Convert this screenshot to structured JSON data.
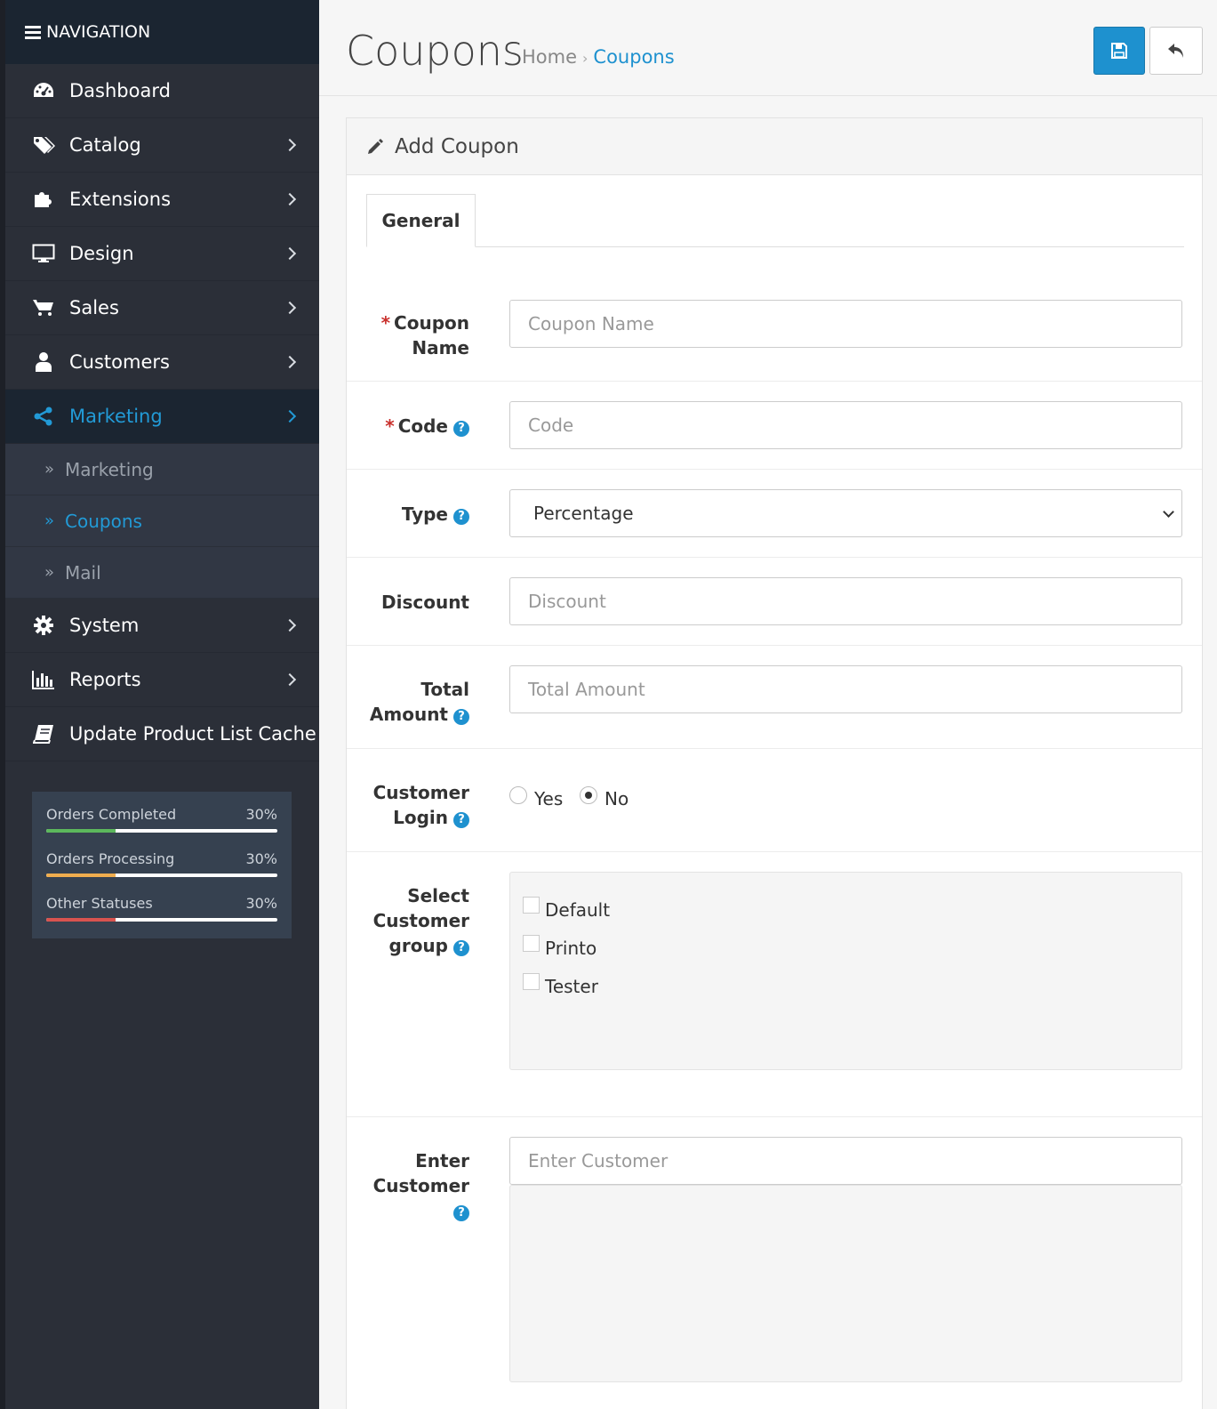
{
  "sidebar": {
    "header": "NAVIGATION",
    "items": [
      {
        "label": "Dashboard",
        "icon": "dashboard-icon"
      },
      {
        "label": "Catalog",
        "icon": "tags-icon"
      },
      {
        "label": "Extensions",
        "icon": "puzzle-icon"
      },
      {
        "label": "Design",
        "icon": "monitor-icon"
      },
      {
        "label": "Sales",
        "icon": "cart-icon"
      },
      {
        "label": "Customers",
        "icon": "user-icon"
      },
      {
        "label": "Marketing",
        "icon": "share-icon"
      },
      {
        "label": "System",
        "icon": "gear-icon"
      },
      {
        "label": "Reports",
        "icon": "bar-chart-icon"
      },
      {
        "label": "Update Product List Cache",
        "icon": "book-icon"
      }
    ],
    "submenu": [
      {
        "label": "Marketing"
      },
      {
        "label": "Coupons"
      },
      {
        "label": "Mail"
      }
    ],
    "stats": [
      {
        "label": "Orders Completed",
        "value": "30%",
        "fraction": 0.3,
        "color": "#5cb85c"
      },
      {
        "label": "Orders Processing",
        "value": "30%",
        "fraction": 0.3,
        "color": "#f0ad4e"
      },
      {
        "label": "Other Statuses",
        "value": "30%",
        "fraction": 0.3,
        "color": "#d9534f"
      }
    ]
  },
  "header": {
    "title": "Coupons",
    "breadcrumb": {
      "home": "Home",
      "sep": "›",
      "current": "Coupons"
    }
  },
  "panel": {
    "title": "Add Coupon",
    "tab": "General"
  },
  "form": {
    "required_mark": "*",
    "help": "?",
    "coupon_name": {
      "label1": "Coupon",
      "label2": "Name",
      "placeholder": "Coupon Name"
    },
    "code": {
      "label": "Code",
      "placeholder": "Code"
    },
    "type": {
      "label": "Type",
      "value": "Percentage"
    },
    "discount": {
      "label": "Discount",
      "placeholder": "Discount"
    },
    "total": {
      "label1": "Total",
      "label2": "Amount",
      "placeholder": "Total Amount"
    },
    "login": {
      "label1": "Customer",
      "label2": "Login",
      "yes": "Yes",
      "no": "No"
    },
    "group": {
      "label1": "Select",
      "label2": "Customer",
      "label3": "group",
      "options": [
        "Default",
        "Printo",
        "Tester"
      ]
    },
    "customer": {
      "label1": "Enter",
      "label2": "Customer",
      "placeholder": "Enter Customer"
    }
  },
  "colors": {
    "accent": "#1e91cf",
    "sidebar_bg": "#2b2f38",
    "sidebar_header": "#1b2531"
  }
}
